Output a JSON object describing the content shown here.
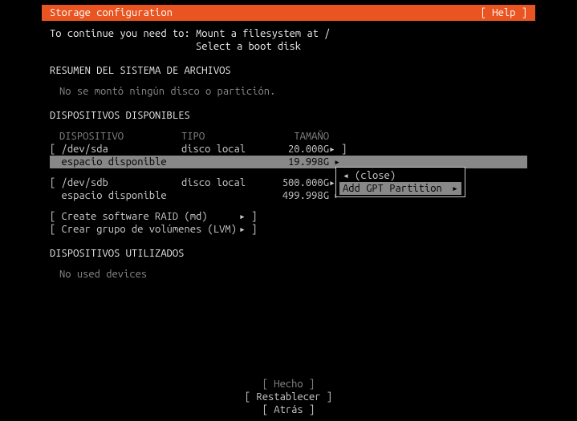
{
  "header": {
    "title": "Storage configuration",
    "help": "[ Help ]"
  },
  "intro": {
    "line1": "To continue you need to: Mount a filesystem at /",
    "line2": "                         Select a boot disk"
  },
  "summary": {
    "heading": "RESUMEN DEL SISTEMA DE ARCHIVOS",
    "none": "No se montó ningún disco o partición."
  },
  "available": {
    "heading": "DISPOSITIVOS DISPONIBLES",
    "cols": {
      "dev": "DISPOSITIVO",
      "tipo": "TIPO",
      "tam": "TAMAÑO"
    },
    "sda": {
      "label": "[ /dev/sda",
      "tipo": "disco local",
      "size": "20.000G",
      "arrow": "▸ ]",
      "free_label": "  espacio disponible",
      "free_size": "19.998G",
      "free_arrow": "▸"
    },
    "sdb": {
      "label": "[ /dev/sdb",
      "tipo": "disco local",
      "size": "500.000G",
      "arrow": "▸ ]",
      "free_label": "  espacio disponible",
      "free_size": "499.998G",
      "free_arrow": "▸"
    },
    "raid": {
      "label": "[ Create software RAID (md)",
      "arrow": "▸ ]"
    },
    "lvm": {
      "label": "[ Crear grupo de volúmenes (LVM)",
      "arrow": "▸ ]"
    }
  },
  "used": {
    "heading": "DISPOSITIVOS UTILIZADOS",
    "none": "No used devices"
  },
  "menu": {
    "close": "◂ (close)",
    "add": "Add GPT Partition",
    "add_arrow": "▸"
  },
  "footer": {
    "done": "[ Hecho ]",
    "reset": "[ Restablecer ]",
    "back": "[ Atrás ]"
  }
}
